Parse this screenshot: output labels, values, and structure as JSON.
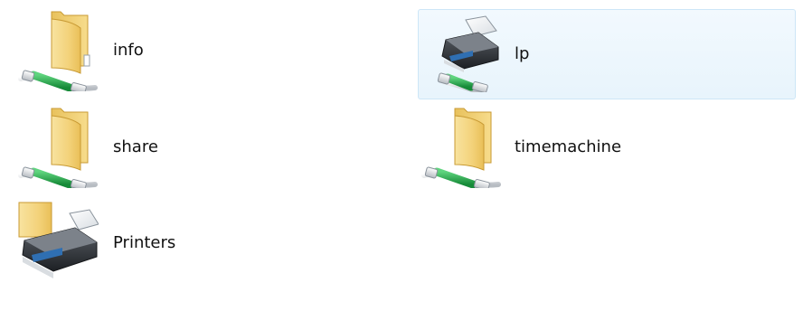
{
  "items": [
    {
      "label": "info",
      "type": "shared-folder",
      "icon": "network-folder-icon"
    },
    {
      "label": "lp",
      "type": "shared-printer",
      "icon": "network-printer-icon"
    },
    {
      "label": "share",
      "type": "shared-folder",
      "icon": "network-folder-icon"
    },
    {
      "label": "timemachine",
      "type": "shared-folder",
      "icon": "network-folder-icon"
    },
    {
      "label": "Printers",
      "type": "printers-folder",
      "icon": "printers-folder-icon"
    }
  ],
  "selected_item": "lp",
  "colors": {
    "background": "#ffffff",
    "selection_fill": "#e8f4fc",
    "selection_border": "#cde6f7",
    "folder": "#f2cd6b",
    "network_cable": "#1fae4a"
  }
}
